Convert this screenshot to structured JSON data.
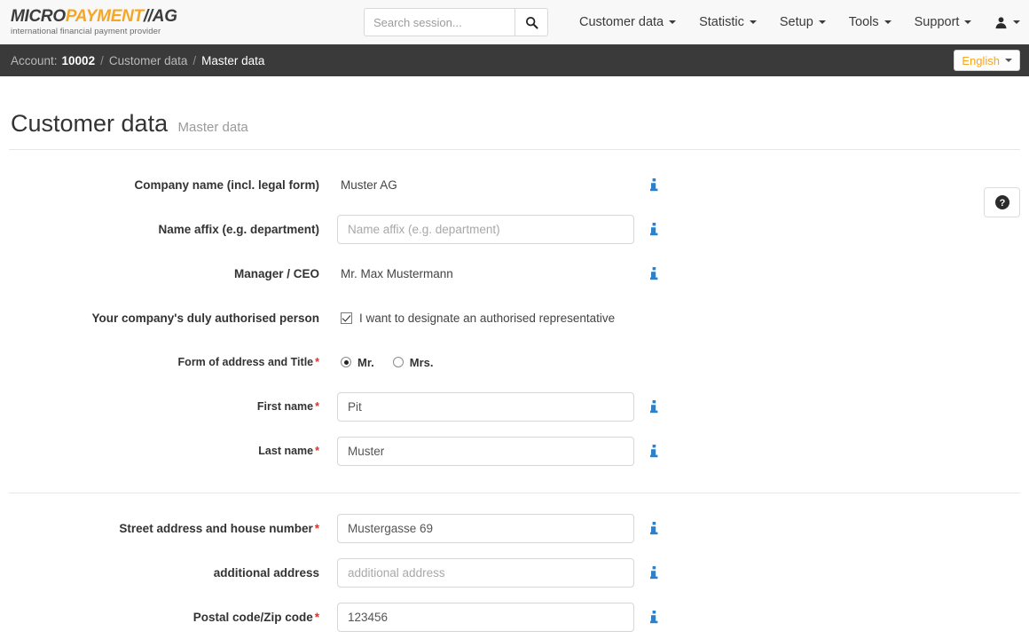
{
  "header": {
    "logo": {
      "part1": "MICRO",
      "part2": "PAYMENT",
      "slash": "//",
      "part3": "AG",
      "tagline": "international financial payment provider"
    },
    "search": {
      "placeholder": "Search session...",
      "value": "",
      "icon": "search-icon"
    },
    "nav": [
      {
        "label": "Customer data"
      },
      {
        "label": "Statistic"
      },
      {
        "label": "Setup"
      },
      {
        "label": "Tools"
      },
      {
        "label": "Support"
      }
    ],
    "user_menu": {
      "icon": "user-icon"
    }
  },
  "breadcrumb": {
    "account_label": "Account:",
    "account_number": "10002",
    "sep": "/",
    "section": "Customer data",
    "current": "Master data",
    "language": {
      "label": "English"
    }
  },
  "page": {
    "title": "Customer data",
    "subtitle": "Master data",
    "help_icon": "help-circle-icon"
  },
  "form": {
    "sections": [
      {
        "rows": [
          {
            "label": "Company name (incl. legal form)",
            "required": false,
            "type": "static",
            "value": "Muster AG",
            "info": "info-icon"
          },
          {
            "label": "Name affix (e.g. department)",
            "required": false,
            "type": "input",
            "value": "",
            "placeholder": "Name affix (e.g. department)",
            "info": "info-icon"
          },
          {
            "label": "Manager / CEO",
            "required": false,
            "type": "static",
            "value": "Mr. Max Mustermann",
            "info": "info-icon"
          },
          {
            "label": "Your company's duly authorised person",
            "required": false,
            "type": "checkbox",
            "checked": true,
            "checkbox_label": "I want to designate an authorised representative"
          },
          {
            "label": "Form of address and Title",
            "required": true,
            "type": "radio",
            "options": [
              {
                "label": "Mr.",
                "selected": true
              },
              {
                "label": "Mrs.",
                "selected": false
              }
            ]
          },
          {
            "label": "First name",
            "required": true,
            "type": "input",
            "value": "Pit",
            "placeholder": "",
            "info": "info-icon"
          },
          {
            "label": "Last name",
            "required": true,
            "type": "input",
            "value": "Muster",
            "placeholder": "",
            "info": "info-icon"
          }
        ]
      },
      {
        "rows": [
          {
            "label": "Street address and house number",
            "required": true,
            "type": "input",
            "value": "Mustergasse 69",
            "placeholder": "",
            "info": "info-icon"
          },
          {
            "label": "additional address",
            "required": false,
            "type": "input",
            "value": "",
            "placeholder": "additional address",
            "info": "info-icon"
          },
          {
            "label": "Postal code/Zip code",
            "required": true,
            "type": "input",
            "value": "123456",
            "placeholder": "",
            "info": "info-icon"
          }
        ]
      }
    ]
  },
  "colors": {
    "brand_orange": "#f5a623",
    "dark_bar": "#3a3a3a",
    "info_blue": "#2f80c8",
    "required_red": "#d9342b"
  }
}
